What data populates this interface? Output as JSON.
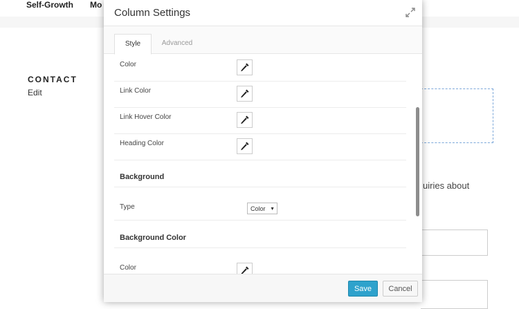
{
  "background_page": {
    "nav": [
      "Self-Growth",
      "Mo"
    ],
    "contact_heading": "CONTACT",
    "edit_link": "Edit",
    "inquiry_text": "uiries about"
  },
  "modal": {
    "title": "Column Settings",
    "tabs": [
      {
        "label": "Style",
        "active": true
      },
      {
        "label": "Advanced",
        "active": false
      }
    ],
    "color_rows": [
      {
        "label": "Color"
      },
      {
        "label": "Link Color"
      },
      {
        "label": "Link Hover Color"
      },
      {
        "label": "Heading Color"
      }
    ],
    "background_section": {
      "title": "Background",
      "type_label": "Type",
      "type_value": "Color"
    },
    "background_color_section": {
      "title": "Background Color",
      "color_label": "Color"
    },
    "footer": {
      "save_label": "Save",
      "cancel_label": "Cancel"
    }
  },
  "colors": {
    "primary_button": "#2ea2cc",
    "dashed_outline": "#7ba7d9"
  },
  "icons": {
    "expand": "expand-icon",
    "color_picker": "eyedropper-icon"
  }
}
